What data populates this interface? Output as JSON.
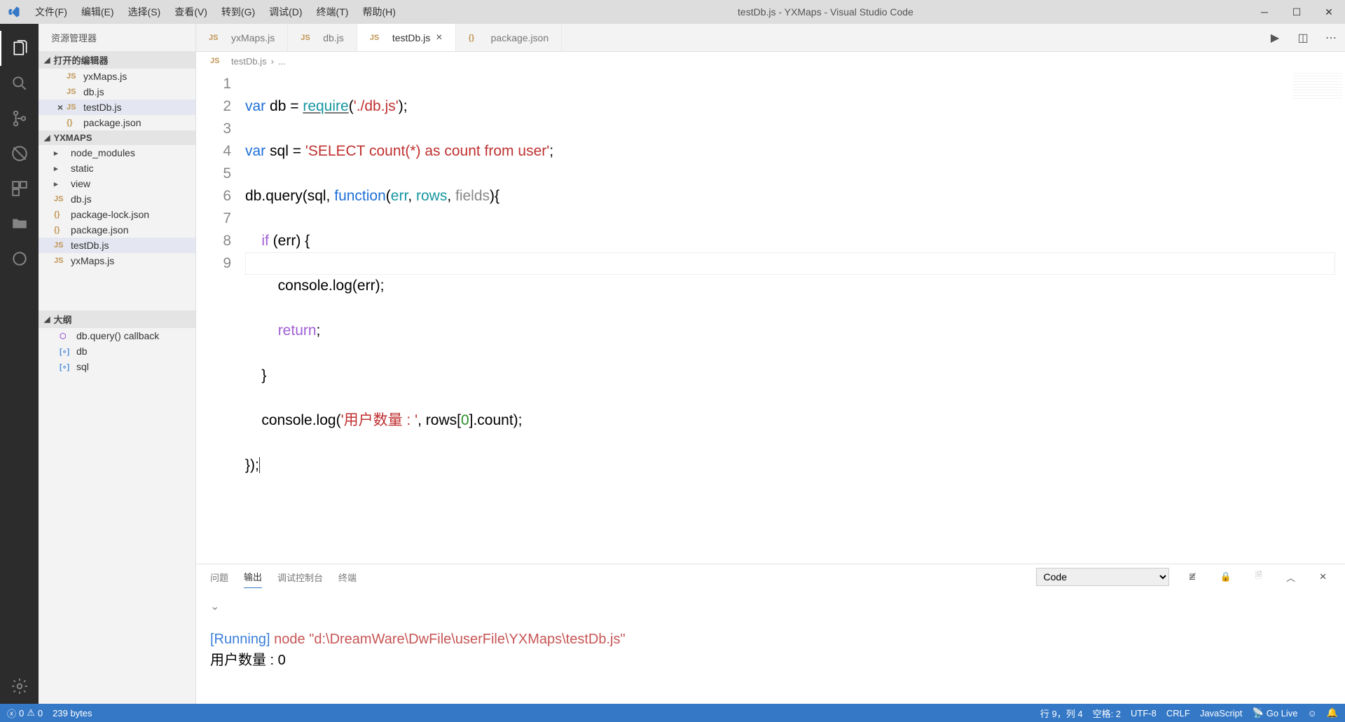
{
  "title": "testDb.js - YXMaps - Visual Studio Code",
  "menu": {
    "file": "文件(F)",
    "edit": "编辑(E)",
    "select": "选择(S)",
    "view": "查看(V)",
    "goto": "转到(G)",
    "debug": "调试(D)",
    "terminal": "终端(T)",
    "help": "帮助(H)"
  },
  "sidebar": {
    "title": "资源管理器",
    "openEditors": "打开的编辑器",
    "openFiles": [
      "yxMaps.js",
      "db.js",
      "testDb.js",
      "package.json"
    ],
    "workspace": "YXMAPS",
    "folders": [
      "node_modules",
      "static",
      "view"
    ],
    "files": [
      "db.js",
      "package-lock.json",
      "package.json",
      "testDb.js",
      "yxMaps.js"
    ],
    "outline": "大纲",
    "outlineItems": [
      "db.query() callback",
      "db",
      "sql"
    ]
  },
  "tabs": {
    "t0": "yxMaps.js",
    "t1": "db.js",
    "t2": "testDb.js",
    "t3": "package.json"
  },
  "breadcrumb": {
    "file": "testDb.js",
    "sep": "›",
    "ell": "..."
  },
  "code": {
    "lines": [
      "1",
      "2",
      "3",
      "4",
      "5",
      "6",
      "7",
      "8",
      "9"
    ],
    "l1a": "var",
    "l1b": " db = ",
    "l1c": "require",
    "l1d": "(",
    "l1e": "'./db.js'",
    "l1f": ");",
    "l2a": "var",
    "l2b": " sql = ",
    "l2c": "'SELECT count(*) as count from user'",
    "l2d": ";",
    "l3a": "db.query(sql, ",
    "l3b": "function",
    "l3c": "(",
    "l3d": "err",
    "l3e": ", ",
    "l3f": "rows",
    "l3g": ", ",
    "l3h": "fields",
    "l3i": "){",
    "l4a": "    ",
    "l4b": "if",
    "l4c": " (err) {",
    "l5a": "        console.log(err);",
    "l6a": "        ",
    "l6b": "return",
    "l6c": ";",
    "l7a": "    }",
    "l8a": "    console.log(",
    "l8b": "'用户数量 : '",
    "l8c": ", rows[",
    "l8d": "0",
    "l8e": "].count);",
    "l9a": "});"
  },
  "panel": {
    "tabs": {
      "problems": "问题",
      "output": "输出",
      "debug": "调试控制台",
      "terminal": "终端"
    },
    "select": "Code",
    "running": "[Running]",
    "node": " node ",
    "path": "\"d:\\DreamWare\\DwFile\\userFile\\YXMaps\\testDb.js\"",
    "resultLabel": "用户数量 :  ",
    "resultVal": "0"
  },
  "status": {
    "errors": "0",
    "warnings": "0",
    "bytes": "239 bytes",
    "line": "行 9，列 4",
    "spaces": "空格: 2",
    "enc": "UTF-8",
    "eol": "CRLF",
    "lang": "JavaScript",
    "live": "Go Live"
  }
}
